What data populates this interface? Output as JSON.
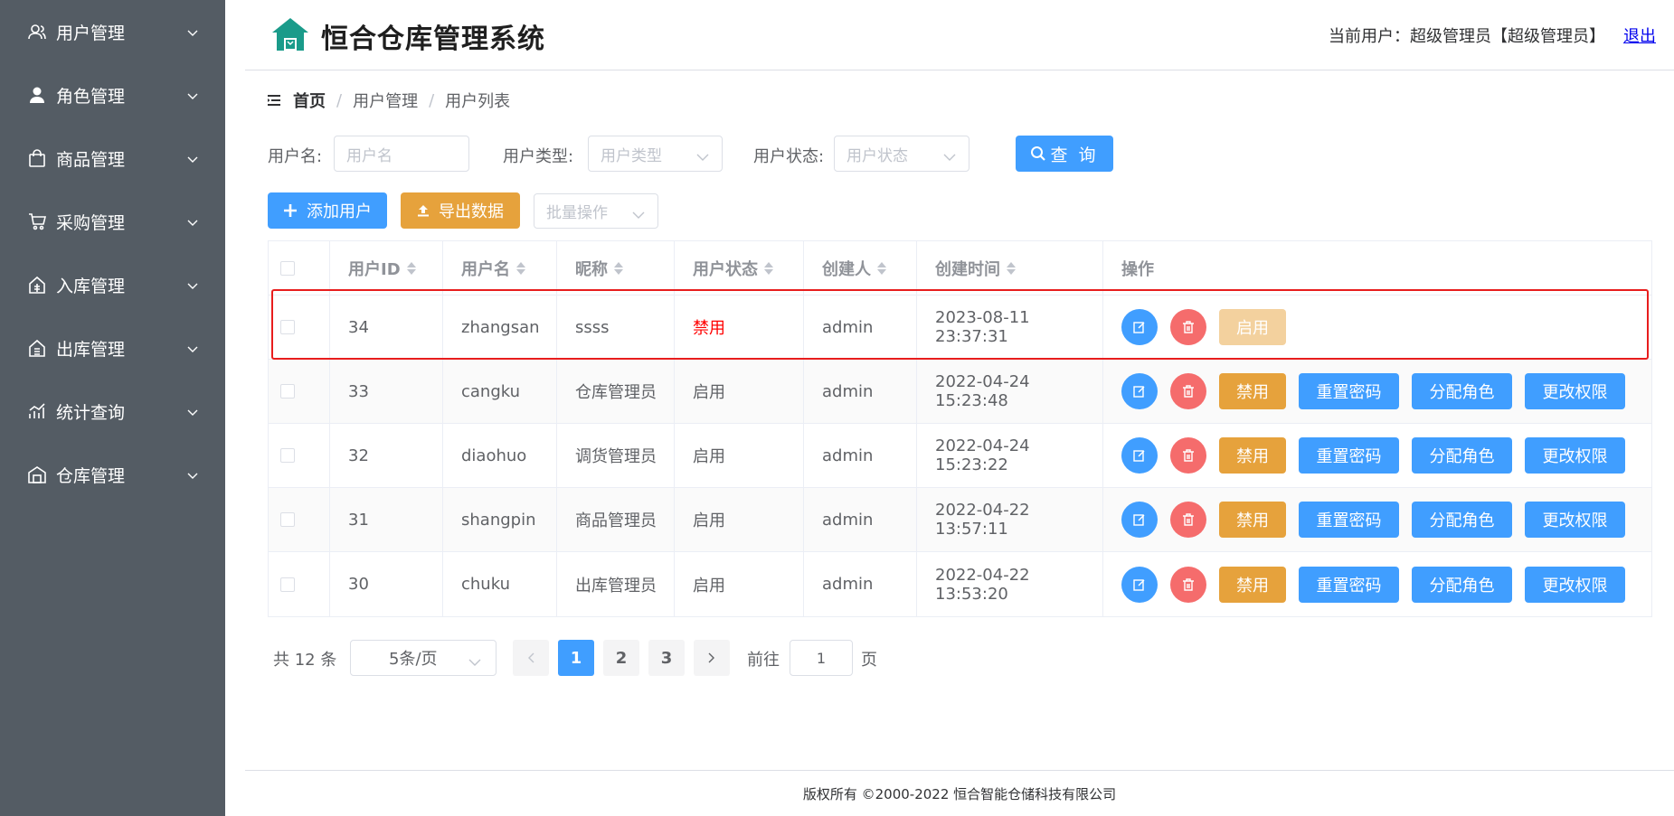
{
  "sidebar": {
    "items": [
      {
        "label": "用户管理",
        "icon": "users-icon"
      },
      {
        "label": "角色管理",
        "icon": "user-icon"
      },
      {
        "label": "商品管理",
        "icon": "bag-icon"
      },
      {
        "label": "采购管理",
        "icon": "cart-icon"
      },
      {
        "label": "入库管理",
        "icon": "inbound-icon"
      },
      {
        "label": "出库管理",
        "icon": "outbound-icon"
      },
      {
        "label": "统计查询",
        "icon": "chart-icon"
      },
      {
        "label": "仓库管理",
        "icon": "warehouse-icon"
      }
    ]
  },
  "header": {
    "title": "恒合仓库管理系统",
    "user_info": "当前用户：超级管理员【超级管理员】",
    "logout": "退出"
  },
  "breadcrumb": [
    "首页",
    "用户管理",
    "用户列表"
  ],
  "filters": {
    "username_label": "用户名:",
    "username_placeholder": "用户名",
    "type_label": "用户类型:",
    "type_placeholder": "用户类型",
    "status_label": "用户状态:",
    "status_placeholder": "用户状态",
    "search_button": "查 询"
  },
  "toolbar": {
    "add_user": "添加用户",
    "export": "导出数据",
    "batch_placeholder": "批量操作"
  },
  "table": {
    "headers": [
      "用户ID",
      "用户名",
      "昵称",
      "用户状态",
      "创建人",
      "创建时间",
      "操作"
    ],
    "rows": [
      {
        "id": "34",
        "username": "zhangsan",
        "nickname": "ssss",
        "status": "禁用",
        "creator": "admin",
        "created": "2023-08-11 23:37:31",
        "toggle": "启用"
      },
      {
        "id": "33",
        "username": "cangku",
        "nickname": "仓库管理员",
        "status": "启用",
        "creator": "admin",
        "created": "2022-04-24 15:23:48",
        "toggle": "禁用"
      },
      {
        "id": "32",
        "username": "diaohuo",
        "nickname": "调货管理员",
        "status": "启用",
        "creator": "admin",
        "created": "2022-04-24 15:23:22",
        "toggle": "禁用"
      },
      {
        "id": "31",
        "username": "shangpin",
        "nickname": "商品管理员",
        "status": "启用",
        "creator": "admin",
        "created": "2022-04-22 13:57:11",
        "toggle": "禁用"
      },
      {
        "id": "30",
        "username": "chuku",
        "nickname": "出库管理员",
        "status": "启用",
        "creator": "admin",
        "created": "2022-04-22 13:53:20",
        "toggle": "禁用"
      }
    ],
    "actions": {
      "reset_password": "重置密码",
      "assign_role": "分配角色",
      "change_permission": "更改权限"
    }
  },
  "pagination": {
    "total": "共 12 条",
    "page_size": "5条/页",
    "pages": [
      "1",
      "2",
      "3"
    ],
    "current_page": 1,
    "goto_label": "前往",
    "goto_value": "1",
    "page_suffix": "页"
  },
  "footer": "版权所有 ©2000-2022  恒合智能仓储科技有限公司",
  "colors": {
    "primary": "#409eff",
    "warning": "#e6a23c",
    "danger": "#f56c6c",
    "sidebar": "#545c64",
    "highlight": "#e81d1d"
  }
}
